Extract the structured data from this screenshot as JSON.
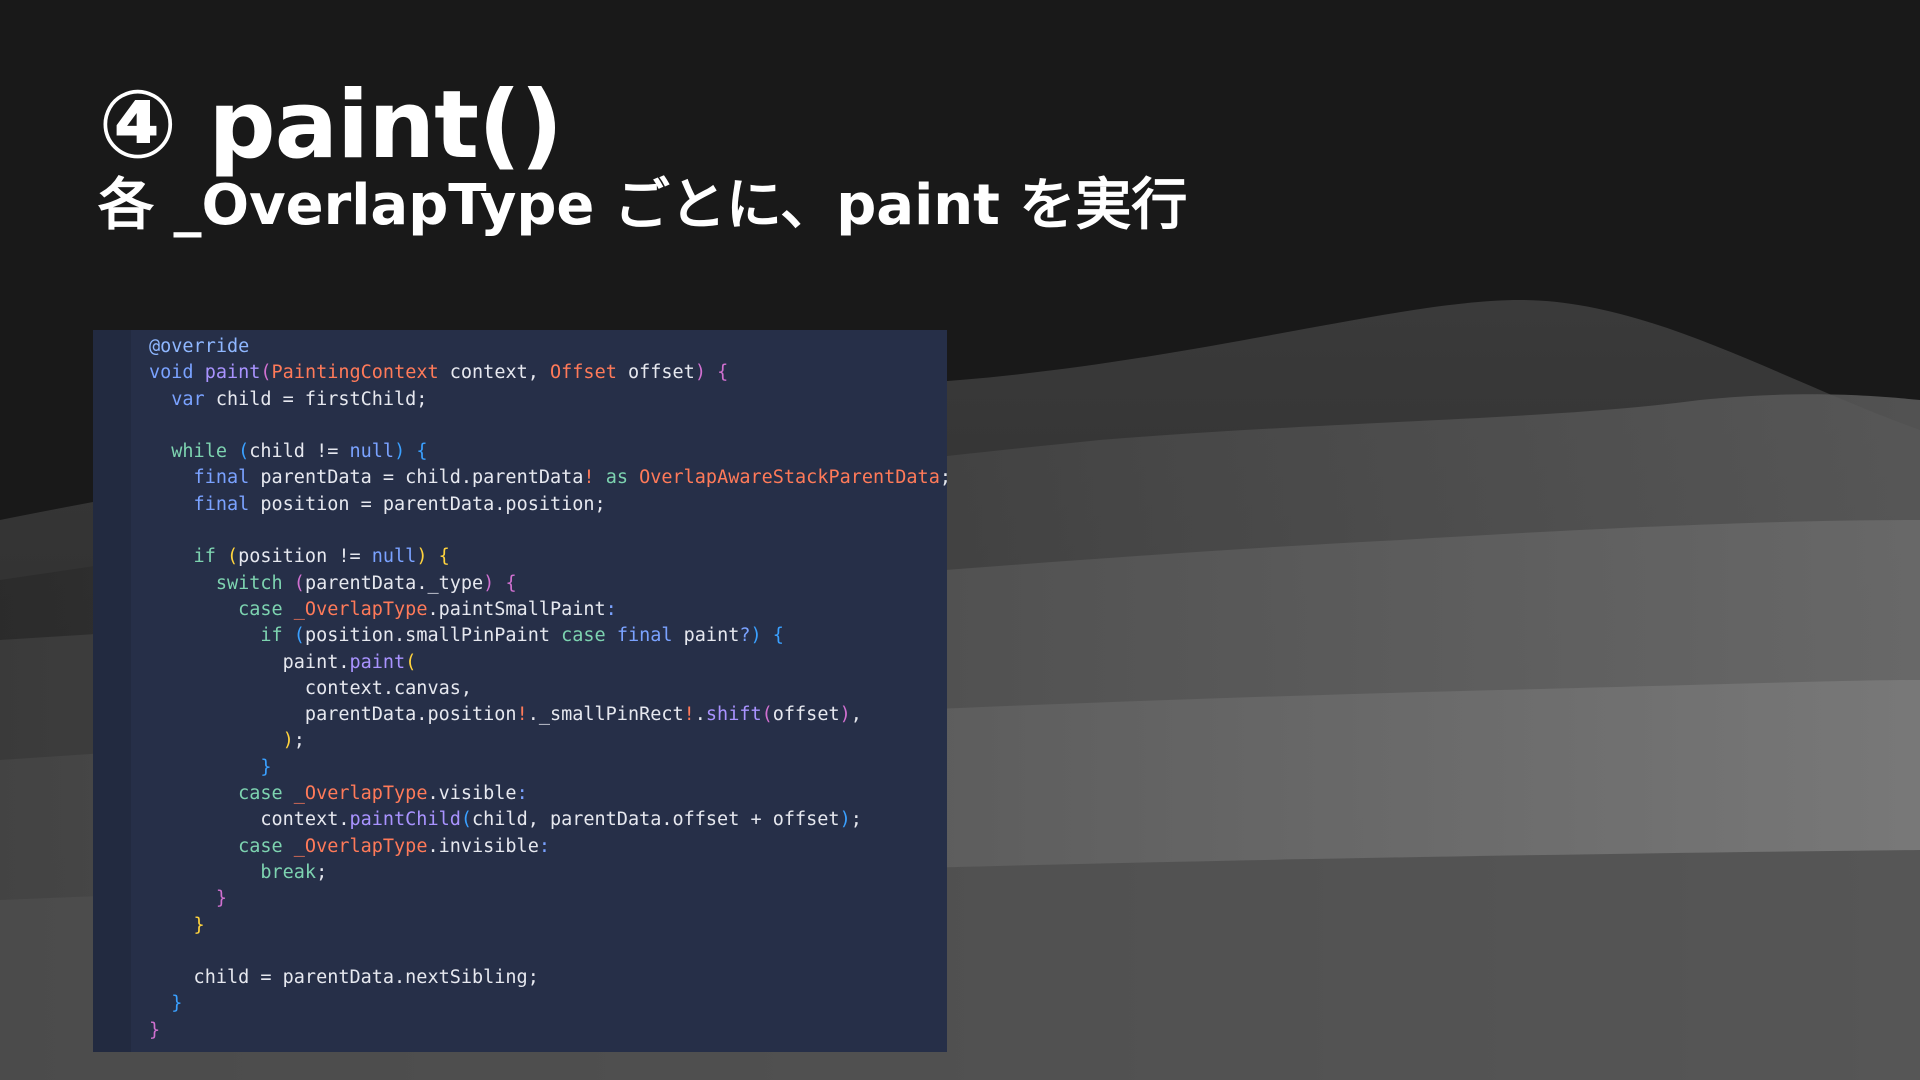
{
  "slide": {
    "title": "④ paint()",
    "subtitle": "各 _OverlapType ごとに、paint を実行"
  },
  "code": {
    "lines": [
      [
        {
          "t": "@override",
          "c": "annot"
        }
      ],
      [
        {
          "t": "void ",
          "c": "kw"
        },
        {
          "t": "paint",
          "c": "fn"
        },
        {
          "t": "(",
          "c": "br2"
        },
        {
          "t": "PaintingContext",
          "c": "type"
        },
        {
          "t": " context, ",
          "c": "ident"
        },
        {
          "t": "Offset",
          "c": "type"
        },
        {
          "t": " offset",
          "c": "ident"
        },
        {
          "t": ") ",
          "c": "br2"
        },
        {
          "t": "{",
          "c": "br2"
        }
      ],
      [
        {
          "t": "  var ",
          "c": "kw"
        },
        {
          "t": "child = firstChild;",
          "c": "ident"
        }
      ],
      [],
      [
        {
          "t": "  while ",
          "c": "ctrl"
        },
        {
          "t": "(",
          "c": "br3"
        },
        {
          "t": "child != ",
          "c": "ident"
        },
        {
          "t": "null",
          "c": "kw"
        },
        {
          "t": ") ",
          "c": "br3"
        },
        {
          "t": "{",
          "c": "br3"
        }
      ],
      [
        {
          "t": "    final ",
          "c": "kw"
        },
        {
          "t": "parentData = child.parentData",
          "c": "ident"
        },
        {
          "t": "! ",
          "c": "type"
        },
        {
          "t": "as ",
          "c": "ctrl"
        },
        {
          "t": "OverlapAwareStackParentData",
          "c": "type"
        },
        {
          "t": ";",
          "c": "ident"
        }
      ],
      [
        {
          "t": "    final ",
          "c": "kw"
        },
        {
          "t": "position = parentData.position;",
          "c": "ident"
        }
      ],
      [],
      [
        {
          "t": "    if ",
          "c": "ctrl"
        },
        {
          "t": "(",
          "c": "br1"
        },
        {
          "t": "position != ",
          "c": "ident"
        },
        {
          "t": "null",
          "c": "kw"
        },
        {
          "t": ") ",
          "c": "br1"
        },
        {
          "t": "{",
          "c": "br1"
        }
      ],
      [
        {
          "t": "      switch ",
          "c": "ctrl"
        },
        {
          "t": "(",
          "c": "br2"
        },
        {
          "t": "parentData._type",
          "c": "ident"
        },
        {
          "t": ") ",
          "c": "br2"
        },
        {
          "t": "{",
          "c": "br2"
        }
      ],
      [
        {
          "t": "        case ",
          "c": "ctrl"
        },
        {
          "t": "_OverlapType",
          "c": "type"
        },
        {
          "t": ".paintSmallPaint",
          "c": "ident"
        },
        {
          "t": ":",
          "c": "kw"
        }
      ],
      [
        {
          "t": "          if ",
          "c": "ctrl"
        },
        {
          "t": "(",
          "c": "br3"
        },
        {
          "t": "position.smallPinPaint ",
          "c": "ident"
        },
        {
          "t": "case ",
          "c": "ctrl"
        },
        {
          "t": "final ",
          "c": "kw"
        },
        {
          "t": "paint",
          "c": "ident"
        },
        {
          "t": "?",
          "c": "kw"
        },
        {
          "t": ") ",
          "c": "br3"
        },
        {
          "t": "{",
          "c": "br3"
        }
      ],
      [
        {
          "t": "            paint.",
          "c": "ident"
        },
        {
          "t": "paint",
          "c": "fn"
        },
        {
          "t": "(",
          "c": "br1"
        }
      ],
      [
        {
          "t": "              context.canvas,",
          "c": "ident"
        }
      ],
      [
        {
          "t": "              parentData.position",
          "c": "ident"
        },
        {
          "t": "!",
          "c": "type"
        },
        {
          "t": "._smallPinRect",
          "c": "ident"
        },
        {
          "t": "!",
          "c": "type"
        },
        {
          "t": ".",
          "c": "ident"
        },
        {
          "t": "shift",
          "c": "fn"
        },
        {
          "t": "(",
          "c": "br2"
        },
        {
          "t": "offset",
          "c": "ident"
        },
        {
          "t": ")",
          "c": "br2"
        },
        {
          "t": ",",
          "c": "ident"
        }
      ],
      [
        {
          "t": "            )",
          "c": "br1"
        },
        {
          "t": ";",
          "c": "ident"
        }
      ],
      [
        {
          "t": "          }",
          "c": "br3"
        }
      ],
      [
        {
          "t": "        case ",
          "c": "ctrl"
        },
        {
          "t": "_OverlapType",
          "c": "type"
        },
        {
          "t": ".visible",
          "c": "ident"
        },
        {
          "t": ":",
          "c": "kw"
        }
      ],
      [
        {
          "t": "          context.",
          "c": "ident"
        },
        {
          "t": "paintChild",
          "c": "fn"
        },
        {
          "t": "(",
          "c": "br3"
        },
        {
          "t": "child, parentData.offset + offset",
          "c": "ident"
        },
        {
          "t": ")",
          "c": "br3"
        },
        {
          "t": ";",
          "c": "ident"
        }
      ],
      [
        {
          "t": "        case ",
          "c": "ctrl"
        },
        {
          "t": "_OverlapType",
          "c": "type"
        },
        {
          "t": ".invisible",
          "c": "ident"
        },
        {
          "t": ":",
          "c": "kw"
        }
      ],
      [
        {
          "t": "          break",
          "c": "ctrl"
        },
        {
          "t": ";",
          "c": "ident"
        }
      ],
      [
        {
          "t": "      }",
          "c": "br2"
        }
      ],
      [
        {
          "t": "    }",
          "c": "br1"
        }
      ],
      [],
      [
        {
          "t": "    child = parentData.nextSibling;",
          "c": "ident"
        }
      ],
      [
        {
          "t": "  }",
          "c": "br3"
        }
      ],
      [
        {
          "t": "}",
          "c": "br2"
        }
      ]
    ]
  }
}
